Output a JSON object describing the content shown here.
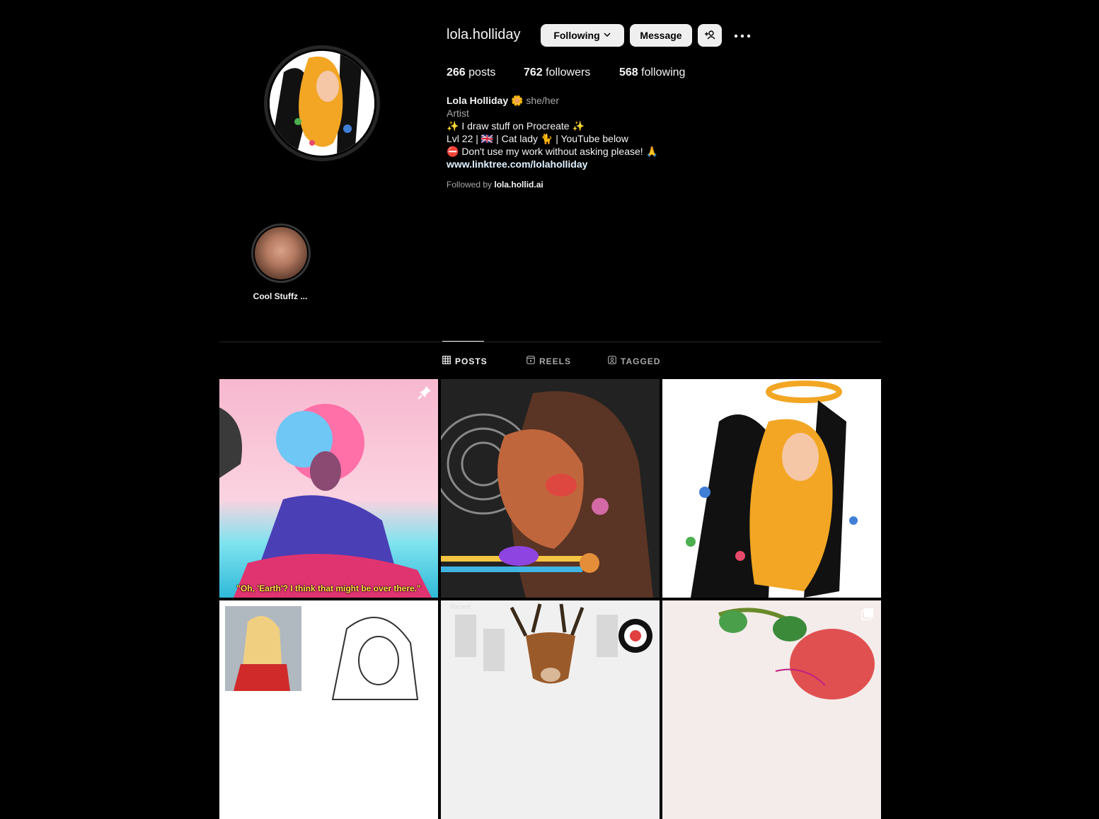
{
  "profile": {
    "username": "lola.holliday",
    "following_btn": "Following",
    "message_btn": "Message",
    "stats": {
      "posts_count": "266",
      "posts_label": "posts",
      "followers_count": "762",
      "followers_label": "followers",
      "following_count": "568",
      "following_label": "following"
    },
    "bio": {
      "name": "Lola Holliday",
      "name_emoji": "🌼",
      "pronouns": "she/her",
      "category": "Artist",
      "line1": "✨  I draw stuff on Procreate  ✨",
      "line2": "Lvl 22 | 🇬🇧 | Cat lady 🐈 | YouTube below",
      "line3": "⛔  Don't use my work without asking please! 🙏",
      "link": "www.linktree.com/lolaholliday"
    },
    "followed_by_prefix": "Followed by",
    "followed_by_user": "lola.hollid.ai"
  },
  "highlights": [
    {
      "label": "Cool Stuffz ..."
    }
  ],
  "tabs": [
    {
      "label": "POSTS",
      "icon": "grid-icon",
      "active": true
    },
    {
      "label": "REELS",
      "icon": "reels-icon",
      "active": false
    },
    {
      "label": "TAGGED",
      "icon": "tagged-icon",
      "active": false
    }
  ],
  "posts": [
    {
      "caption": "\"Oh, 'Earth'? I think that might be over there.\"",
      "pinned": true
    },
    {
      "caption": "",
      "pinned": false
    },
    {
      "caption": "",
      "pinned": false
    },
    {
      "caption": "",
      "pinned": false
    },
    {
      "caption": "",
      "overlay_text": "Recent"
    },
    {
      "caption": "",
      "multi": true
    }
  ],
  "colors": {
    "background": "#000000",
    "button_bg": "#efefef",
    "link": "#e0f1ff",
    "muted": "#a8a8a8"
  }
}
